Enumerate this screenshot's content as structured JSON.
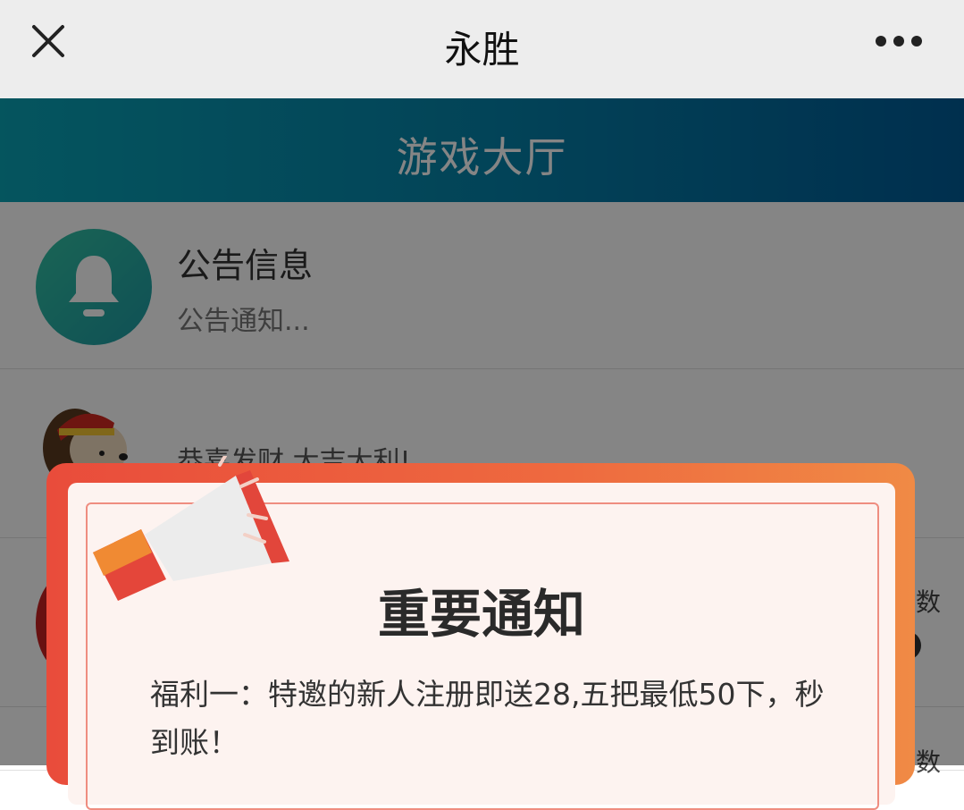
{
  "window": {
    "title": "永胜"
  },
  "header": {
    "title": "游戏大厅"
  },
  "list": {
    "announcement": {
      "title": "公告信息",
      "subtitle": "公告通知..."
    },
    "item2": {
      "text": "恭喜发财,大吉大利!"
    },
    "item3": {
      "side_text": "数"
    },
    "item4": {
      "side_text": "数"
    }
  },
  "modal": {
    "title": "重要通知",
    "body": "福利一：特邀的新人注册即送28,五把最低50下，秒到账！"
  },
  "colors": {
    "header_start": "#0aa3b5",
    "header_end": "#005b96",
    "modal_border": "#e94c3b",
    "modal_bg": "#fdf3f0"
  }
}
